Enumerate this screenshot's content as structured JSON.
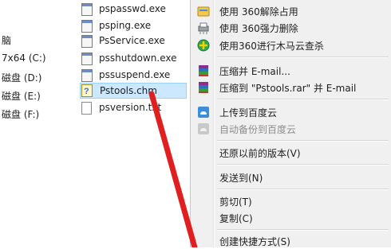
{
  "nav": {
    "items": [
      {
        "label": "脑"
      },
      {
        "label": "7x64 (C:)"
      },
      {
        "label": "磁盘 (D:)"
      },
      {
        "label": "磁盘 (E:)"
      },
      {
        "label": "磁盘 (F:)"
      }
    ]
  },
  "files": [
    {
      "name": "pspasswd.exe",
      "icon": "exe-icon"
    },
    {
      "name": "psping.exe",
      "icon": "exe-icon"
    },
    {
      "name": "PsService.exe",
      "icon": "exe-icon"
    },
    {
      "name": "psshutdown.exe",
      "icon": "exe-icon"
    },
    {
      "name": "pssuspend.exe",
      "icon": "exe-icon"
    },
    {
      "name": "Pstools.chm",
      "icon": "chm-help-icon",
      "selected": true
    },
    {
      "name": "psversion.txt",
      "icon": "text-file-icon"
    }
  ],
  "context_menu": {
    "items": [
      {
        "label": "使用 360解除占用",
        "icon": "unlock-icon"
      },
      {
        "label": "使用 360强力删除",
        "icon": "shredder-icon"
      },
      {
        "label": "使用360进行木马云查杀",
        "icon": "shield-scan-icon"
      },
      {
        "label": "压缩并 E-mail...",
        "icon": "winrar-icon"
      },
      {
        "label": "压缩到 \"Pstools.rar\" 并 E-mail",
        "icon": "winrar-icon"
      },
      {
        "label": "上传到百度云",
        "icon": "baidu-cloud-icon"
      },
      {
        "label": "自动备份到百度云",
        "icon": "baidu-cloud-backup-icon",
        "disabled": true
      },
      {
        "label": "还原以前的版本(V)"
      },
      {
        "label": "发送到(N)"
      },
      {
        "label": "剪切(T)"
      },
      {
        "label": "复制(C)"
      },
      {
        "label": "创建快捷方式(S)"
      }
    ]
  },
  "colors": {
    "selection_fill": "#cce8ff",
    "selection_border": "#99d1ff",
    "menu_background": "#f0f0f0",
    "annotation_arrow": "#e02020"
  }
}
